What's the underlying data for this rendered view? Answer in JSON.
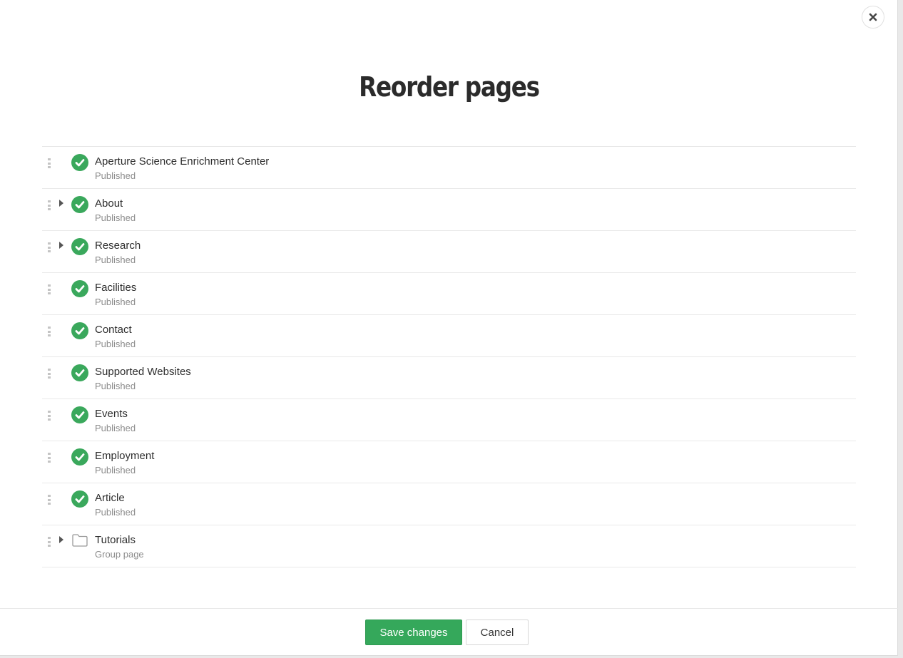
{
  "dialog": {
    "title": "Reorder pages",
    "close_icon": "close-icon"
  },
  "pages": [
    {
      "name": "Aperture Science Enrichment Center",
      "status": "Published",
      "icon": "check-circle-icon",
      "expandable": false
    },
    {
      "name": "About",
      "status": "Published",
      "icon": "check-circle-icon",
      "expandable": true
    },
    {
      "name": "Research",
      "status": "Published",
      "icon": "check-circle-icon",
      "expandable": true
    },
    {
      "name": "Facilities",
      "status": "Published",
      "icon": "check-circle-icon",
      "expandable": false
    },
    {
      "name": "Contact",
      "status": "Published",
      "icon": "check-circle-icon",
      "expandable": false
    },
    {
      "name": "Supported Websites",
      "status": "Published",
      "icon": "check-circle-icon",
      "expandable": false
    },
    {
      "name": "Events",
      "status": "Published",
      "icon": "check-circle-icon",
      "expandable": false
    },
    {
      "name": "Employment",
      "status": "Published",
      "icon": "check-circle-icon",
      "expandable": false
    },
    {
      "name": "Article",
      "status": "Published",
      "icon": "check-circle-icon",
      "expandable": false
    },
    {
      "name": "Tutorials",
      "status": "Group page",
      "icon": "folder-icon",
      "expandable": true
    }
  ],
  "footer": {
    "save_label": "Save changes",
    "cancel_label": "Cancel"
  },
  "colors": {
    "accent": "#35a85b",
    "published": "#3aa85c"
  }
}
